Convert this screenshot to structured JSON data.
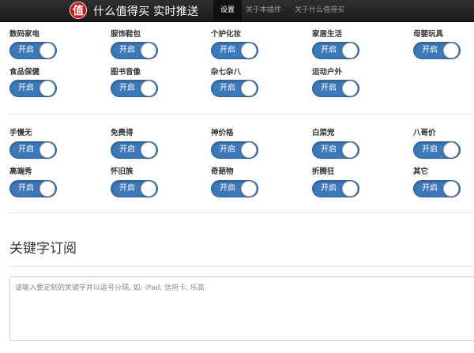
{
  "header": {
    "logo_char": "值",
    "brand": "什么值得买 实时推送",
    "nav": [
      {
        "label": "设置",
        "active": true
      },
      {
        "label": "关于本插件",
        "active": false
      },
      {
        "label": "关于什么值得买",
        "active": false
      }
    ]
  },
  "toggle_on_label": "开启",
  "categories": [
    {
      "label": "数码家电",
      "state": "开启"
    },
    {
      "label": "服饰鞋包",
      "state": "开启"
    },
    {
      "label": "个护化妆",
      "state": "开启"
    },
    {
      "label": "家居生活",
      "state": "开启"
    },
    {
      "label": "母婴玩具",
      "state": "开启"
    },
    {
      "label": "食品保健",
      "state": "开启"
    },
    {
      "label": "图书音像",
      "state": "开启"
    },
    {
      "label": "杂七杂八",
      "state": "开启"
    },
    {
      "label": "运动户外",
      "state": "开启"
    }
  ],
  "tags": [
    {
      "label": "手慢无",
      "state": "开启"
    },
    {
      "label": "免费得",
      "state": "开启"
    },
    {
      "label": "神价格",
      "state": "开启"
    },
    {
      "label": "白菜党",
      "state": "开启"
    },
    {
      "label": "八哥价",
      "state": "开启"
    },
    {
      "label": "高端秀",
      "state": "开启"
    },
    {
      "label": "怀旧族",
      "state": "开启"
    },
    {
      "label": "奇葩物",
      "state": "开启"
    },
    {
      "label": "折腾狂",
      "state": "开启"
    },
    {
      "label": "其它",
      "state": "开启"
    }
  ],
  "keywords": {
    "title": "关键字订阅",
    "placeholder": "请输入要定制的关键字并以逗号分隔, 如: iPad, 信用卡, 乐高",
    "value": ""
  }
}
